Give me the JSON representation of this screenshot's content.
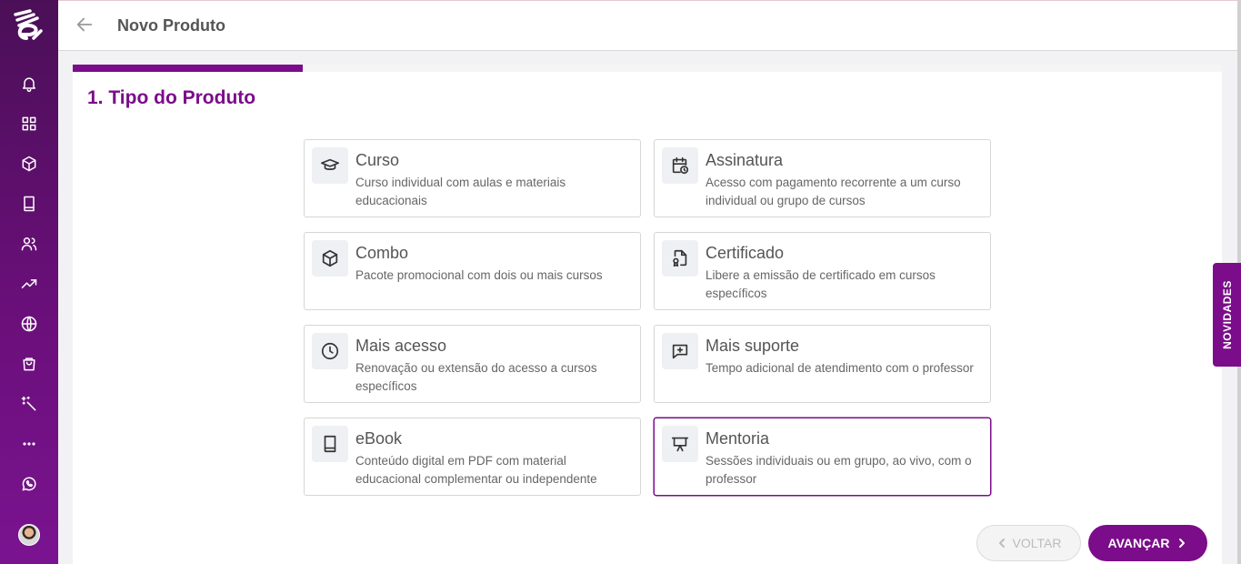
{
  "header": {
    "title": "Novo Produto"
  },
  "section": {
    "title": "1. Tipo do Produto"
  },
  "product_types": [
    {
      "title": "Curso",
      "description": "Curso individual com aulas e materiais educacionais",
      "icon": "graduation-cap-icon"
    },
    {
      "title": "Assinatura",
      "description": "Acesso com pagamento recorrente a um curso individual ou grupo de cursos",
      "icon": "calendar-clock-icon"
    },
    {
      "title": "Combo",
      "description": "Pacote promocional com dois ou mais cursos",
      "icon": "box-icon"
    },
    {
      "title": "Certificado",
      "description": "Libere a emissão de certificado em cursos específicos",
      "icon": "certificate-file-icon"
    },
    {
      "title": "Mais acesso",
      "description": "Renovação ou extensão do acesso a cursos específicos",
      "icon": "clock-icon"
    },
    {
      "title": "Mais suporte",
      "description": "Tempo adicional de atendimento com o professor",
      "icon": "message-plus-icon"
    },
    {
      "title": "eBook",
      "description": "Conteúdo digital em PDF com material educacional complementar ou independente",
      "icon": "book-icon"
    },
    {
      "title": "Mentoria",
      "description": "Sessões individuais ou em grupo, ao vivo, com o professor",
      "icon": "presentation-icon"
    }
  ],
  "selected_type": "Mentoria",
  "buttons": {
    "back": "VOLTAR",
    "next": "AVANÇAR"
  },
  "novidades": "NOVIDADES",
  "sidebar_icons": [
    "bell-icon",
    "grid-icon",
    "box-icon",
    "book-icon",
    "users-icon",
    "trending-up-icon",
    "globe-icon",
    "shopping-bag-icon",
    "magic-wand-icon",
    "more-icon",
    "whatsapp-icon"
  ],
  "colors": {
    "brand": "#7b0c8a",
    "sidebar_top": "#4b0f57",
    "sidebar_bottom": "#7a1390"
  }
}
